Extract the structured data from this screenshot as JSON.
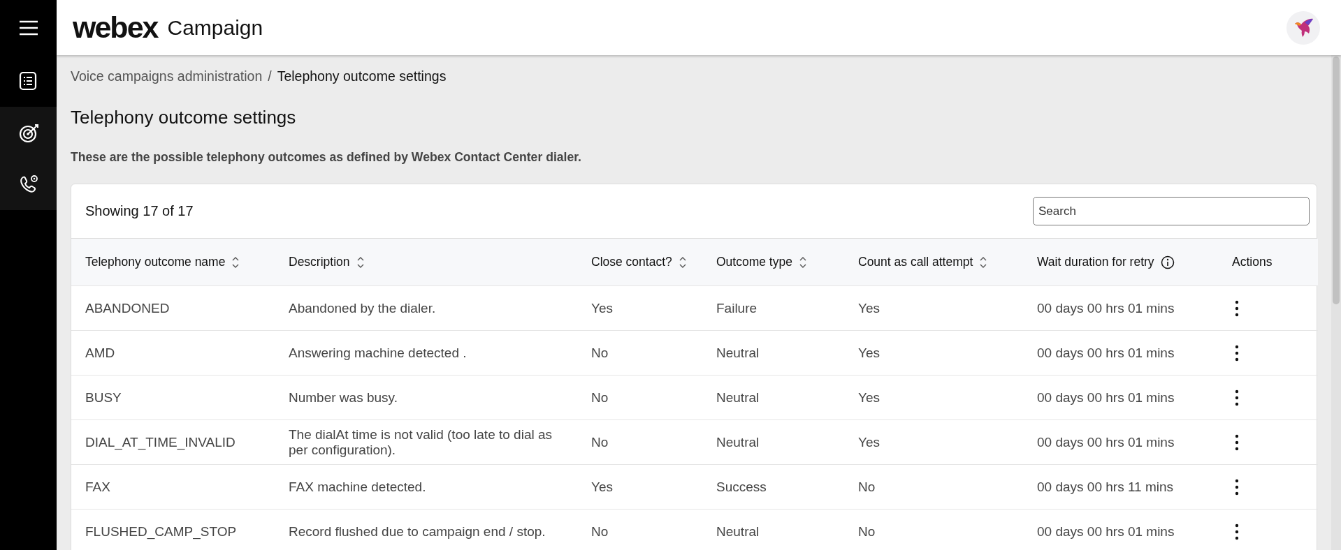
{
  "app": {
    "brand": "webex",
    "product": "Campaign"
  },
  "sidebar": {
    "groups": [
      {
        "highlighted": false,
        "items": [
          {
            "kind": "list"
          }
        ]
      },
      {
        "highlighted": true,
        "items": [
          {
            "kind": "target"
          },
          {
            "kind": "phone"
          }
        ]
      }
    ]
  },
  "breadcrumb": [
    {
      "label": "Voice campaigns administration",
      "current": false
    },
    {
      "label": "Telephony outcome settings",
      "current": true
    }
  ],
  "breadcrumb_separator": "/",
  "page": {
    "title": "Telephony outcome settings",
    "subtitle": "These are the possible telephony outcomes as defined by Webex Contact Center dialer."
  },
  "table": {
    "count": "Showing 17 of 17",
    "search": {
      "placeholder": "Search"
    },
    "columns": [
      {
        "label": "Telephony outcome name",
        "sortable": true,
        "info": false
      },
      {
        "label": "Description",
        "sortable": true,
        "info": false
      },
      {
        "label": "Close contact?",
        "sortable": true,
        "info": false
      },
      {
        "label": "Outcome type",
        "sortable": true,
        "info": false
      },
      {
        "label": "Count as call attempt",
        "sortable": true,
        "info": false
      },
      {
        "label": "Wait duration for retry",
        "sortable": false,
        "info": true
      },
      {
        "label": "Actions",
        "sortable": false,
        "info": false
      }
    ],
    "rows": [
      {
        "cells": [
          "ABANDONED",
          "Abandoned by the dialer.",
          "Yes",
          "Failure",
          "Yes",
          "00 days 00 hrs 01 mins"
        ]
      },
      {
        "cells": [
          "AMD",
          "Answering machine detected .",
          "No",
          "Neutral",
          "Yes",
          "00 days 00 hrs 01 mins"
        ]
      },
      {
        "cells": [
          "BUSY",
          "Number was busy.",
          "No",
          "Neutral",
          "Yes",
          "00 days 00 hrs 01 mins"
        ]
      },
      {
        "cells": [
          "DIAL_AT_TIME_INVALID",
          "The dialAt time is not valid (too late to dial as per configuration).",
          "No",
          "Neutral",
          "Yes",
          "00 days 00 hrs 01 mins"
        ]
      },
      {
        "cells": [
          "FAX",
          "FAX machine detected.",
          "Yes",
          "Success",
          "No",
          "00 days 00 hrs 11 mins"
        ]
      },
      {
        "cells": [
          "FLUSHED_CAMP_STOP",
          "Record flushed due to campaign end / stop.",
          "No",
          "Neutral",
          "No",
          "00 days 00 hrs 01 mins"
        ]
      }
    ]
  }
}
